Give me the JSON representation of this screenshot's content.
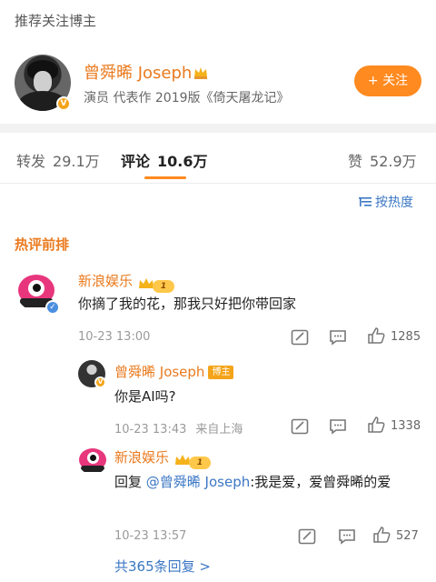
{
  "section_title": "推荐关注博主",
  "blogger": {
    "name": "曾舜晞 Joseph",
    "desc": "演员 代表作 2019版《倚天屠龙记》",
    "follow_label": "+ 关注"
  },
  "tabs": [
    {
      "label": "转发",
      "count": "29.1万"
    },
    {
      "label": "评论",
      "count": "10.6万"
    },
    {
      "label": "赞",
      "count": "52.9万"
    }
  ],
  "sort_label": "按热度",
  "hot_title": "热评前排",
  "comments": [
    {
      "user": "新浪娱乐",
      "level": "1",
      "text": "你摘了我的花，那我只好把你带回家",
      "time": "10-23 13:00",
      "likes": "1285"
    }
  ],
  "replies": [
    {
      "user": "曾舜晞 Joseph",
      "badge": "博主",
      "text": "你是AI吗?",
      "time": "10-23 13:43",
      "location": "来自上海",
      "likes": "1338"
    },
    {
      "user": "新浪娱乐",
      "level": "1",
      "prefix": "回复 ",
      "mention": "@曾舜晞 Joseph",
      "text_rest": ":我是爱，爱曾舜晞的爱",
      "time": "10-23 13:57",
      "likes": "527"
    }
  ],
  "more_replies": "共365条回复 >",
  "colors": {
    "accent": "#ff8a1f",
    "name": "#ea7a1e",
    "link": "#3b77c4",
    "verified": "#f4a41a"
  }
}
